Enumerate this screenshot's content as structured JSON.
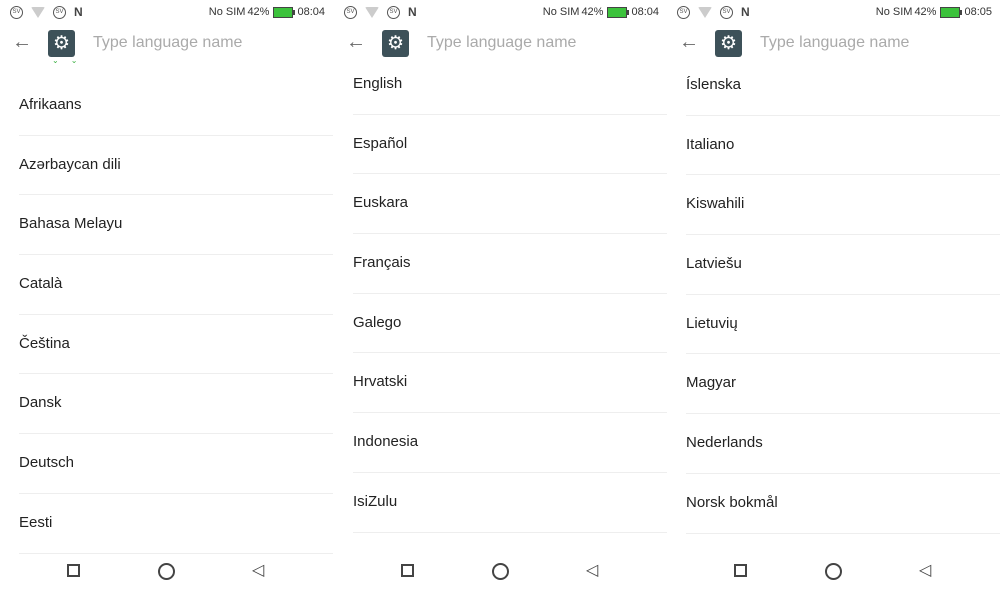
{
  "panels": [
    {
      "status": {
        "carrier": "No SIM",
        "battery": "42%",
        "time": "08:04"
      },
      "search_placeholder": "Type language name",
      "languages": [
        "Afrikaans",
        "Azərbaycan dili",
        "Bahasa Melayu",
        "Català",
        "Čeština",
        "Dansk",
        "Deutsch",
        "Eesti"
      ]
    },
    {
      "status": {
        "carrier": "No SIM",
        "battery": "42%",
        "time": "08:04"
      },
      "search_placeholder": "Type language name",
      "languages": [
        "English",
        "Español",
        "Euskara",
        "Français",
        "Galego",
        "Hrvatski",
        "Indonesia",
        "IsiZulu"
      ]
    },
    {
      "status": {
        "carrier": "No SIM",
        "battery": "42%",
        "time": "08:05"
      },
      "search_placeholder": "Type language name",
      "languages": [
        "Íslenska",
        "Italiano",
        "Kiswahili",
        "Latviešu",
        "Lietuvių",
        "Magyar",
        "Nederlands",
        "Norsk bokmål"
      ]
    }
  ],
  "colors": {
    "gear_bg": "#3d5159",
    "battery": "#3cc23c"
  }
}
